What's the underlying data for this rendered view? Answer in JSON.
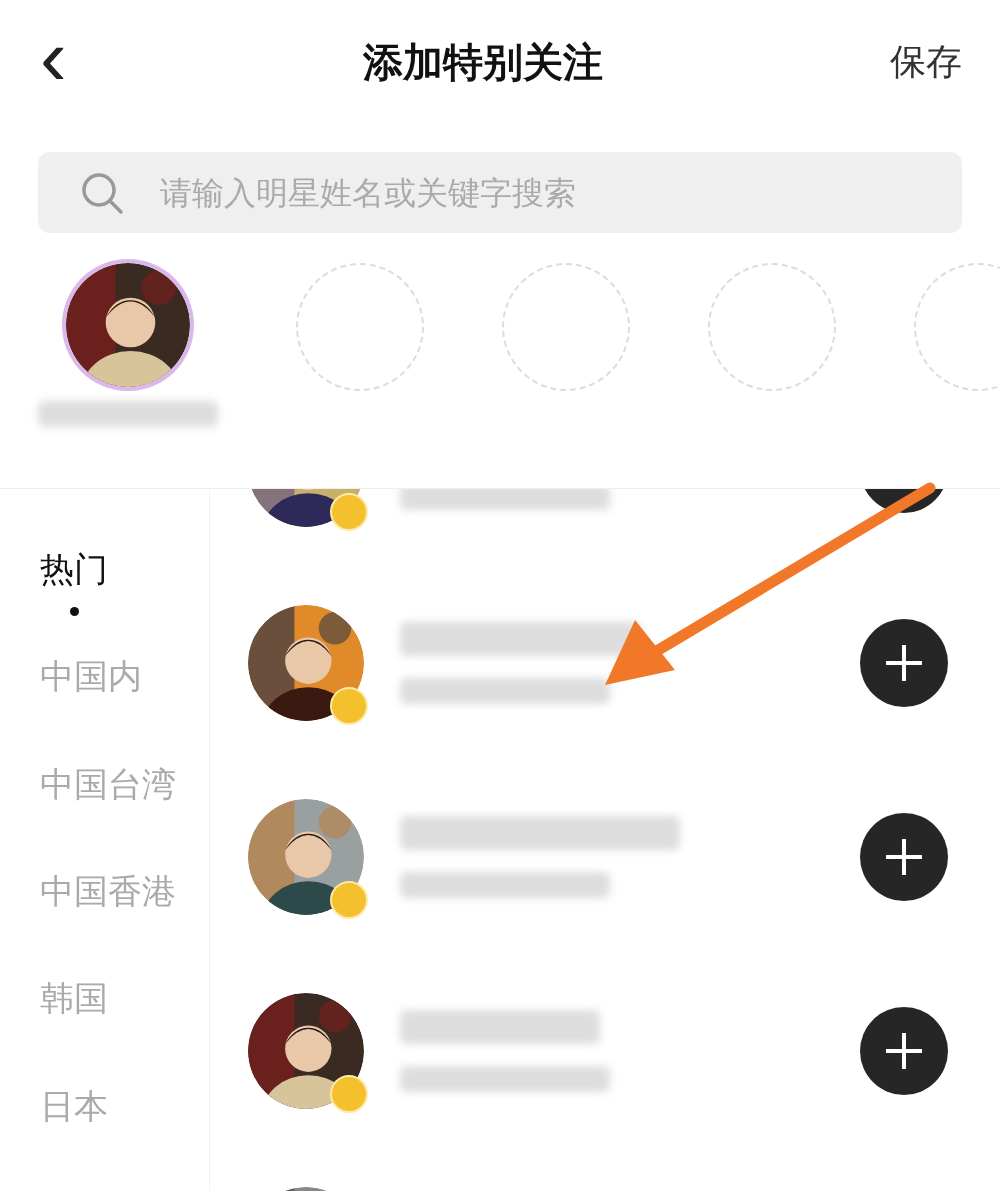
{
  "header": {
    "back": "‹",
    "title": "添加特别关注",
    "save": "保存"
  },
  "search": {
    "placeholder": "请输入明星姓名或关键字搜索"
  },
  "slots": [
    {
      "kind": "filled"
    },
    {
      "kind": "empty"
    },
    {
      "kind": "empty"
    },
    {
      "kind": "empty"
    },
    {
      "kind": "empty"
    }
  ],
  "categories": [
    {
      "label": "热门",
      "selected": true
    },
    {
      "label": "中国内",
      "selected": false
    },
    {
      "label": "中国台湾",
      "selected": false
    },
    {
      "label": "中国香港",
      "selected": false
    },
    {
      "label": "韩国",
      "selected": false
    },
    {
      "label": "日本",
      "selected": false
    }
  ],
  "rows": [
    {
      "kind": "artist_top_cut"
    },
    {
      "kind": "artist"
    },
    {
      "kind": "artist"
    },
    {
      "kind": "artist"
    },
    {
      "kind": "artist_bottom_cut"
    }
  ]
}
